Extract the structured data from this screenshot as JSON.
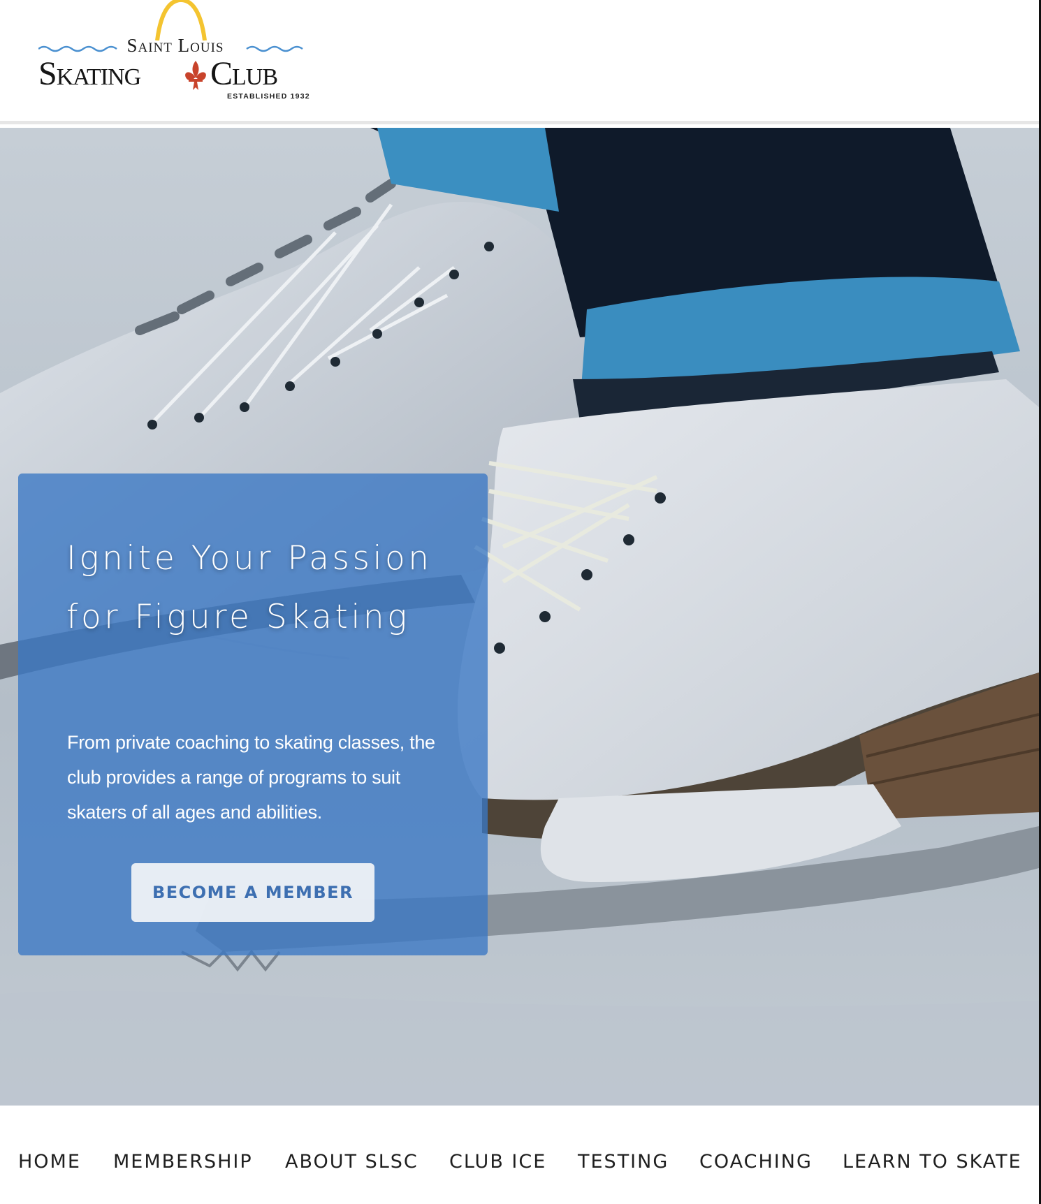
{
  "logo": {
    "top_text": "Saint Louis",
    "word_left": "Skating",
    "word_right": "Club",
    "established": "ESTABLISHED 1932"
  },
  "hero": {
    "title": "Ignite Your Passion for Figure Skating",
    "body": "From private coaching to skating classes, the club provides a range of programs to suit skaters of all ages and abilities.",
    "cta_label": "BECOME A MEMBER"
  },
  "nav": {
    "items": [
      "HOME",
      "MEMBERSHIP",
      "ABOUT SLSC",
      "CLUB ICE",
      "TESTING",
      "COACHING",
      "LEARN TO SKATE"
    ]
  },
  "colors": {
    "card_blue": "#3a77c4",
    "cta_text": "#3d6fb1",
    "arch_gold": "#f4c430",
    "fleur_red": "#c8432b",
    "wave_blue": "#4a90d0"
  }
}
